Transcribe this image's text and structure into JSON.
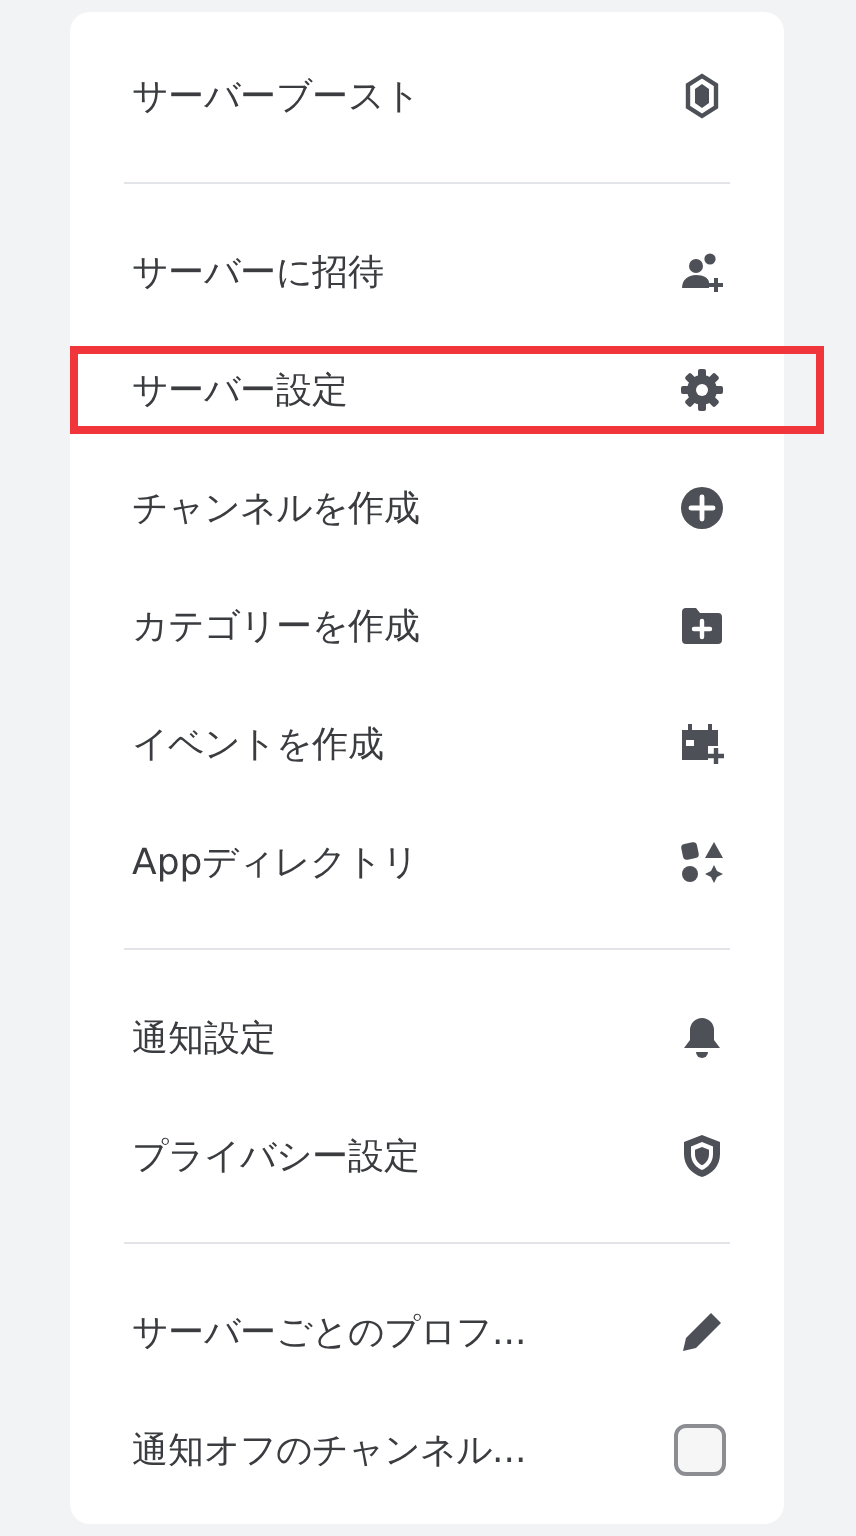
{
  "menu": {
    "groups": [
      {
        "items": [
          {
            "label": "サーバーブースト",
            "kind": "icon",
            "highlighted": false
          }
        ]
      },
      {
        "items": [
          {
            "label": "サーバーに招待",
            "kind": "icon",
            "highlighted": false
          },
          {
            "label": "サーバー設定",
            "kind": "icon",
            "highlighted": true
          },
          {
            "label": "チャンネルを作成",
            "kind": "icon",
            "highlighted": false
          },
          {
            "label": "カテゴリーを作成",
            "kind": "icon",
            "highlighted": false
          },
          {
            "label": "イベントを作成",
            "kind": "icon",
            "highlighted": false
          },
          {
            "label": "Appディレクトリ",
            "kind": "icon",
            "highlighted": false
          }
        ]
      },
      {
        "items": [
          {
            "label": "通知設定",
            "kind": "icon",
            "highlighted": false
          },
          {
            "label": "プライバシー設定",
            "kind": "icon",
            "highlighted": false
          }
        ]
      },
      {
        "items": [
          {
            "label": "サーバーごとのプロフ...",
            "kind": "icon",
            "highlighted": false
          },
          {
            "label": "通知オフのチャンネル...",
            "kind": "checkbox",
            "checked": false,
            "highlighted": false
          }
        ]
      }
    ]
  }
}
